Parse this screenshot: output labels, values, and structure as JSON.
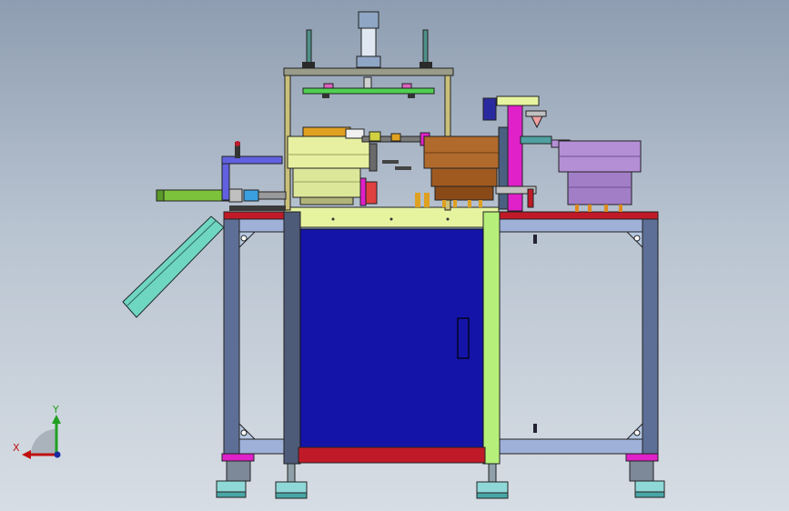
{
  "axis_triad": {
    "x_label": "X",
    "y_label": "Y"
  },
  "colors": {
    "background_top": "#8e9db1",
    "background_bottom": "#d7dde4",
    "cabinet_door": "#1414a8",
    "frame": "#5d6f96",
    "frame_light": "#9fb1d8",
    "frame_edge": "#b6f07a",
    "table_top": "#c01a28",
    "bowl_feeder_left": "#e6f0a0",
    "bowl_feeder_center": "#b06a2c",
    "bowl_feeder_right": "#b48fd6",
    "chute": "#6fd6c2",
    "magenta_parts": "#e020c8",
    "feet": "#8fd8d8"
  }
}
